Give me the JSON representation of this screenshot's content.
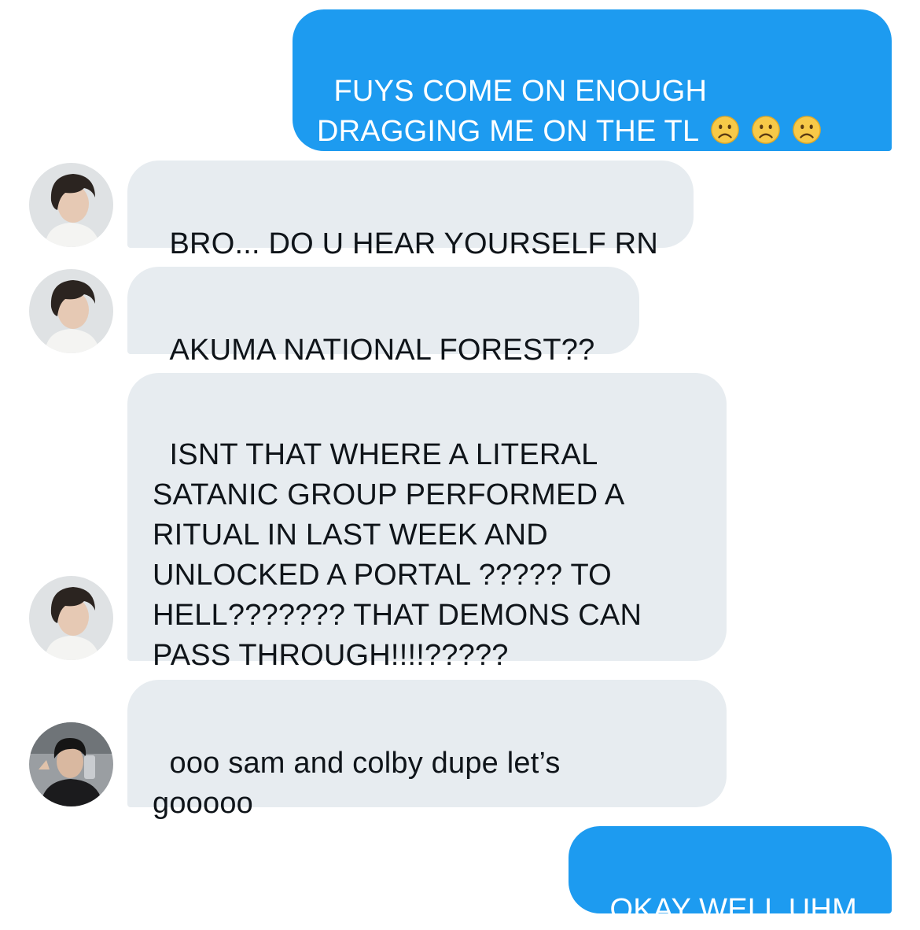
{
  "messages": [
    {
      "id": "m1",
      "side": "sent",
      "text": "FUYS COME ON ENOUGH\nDRAGGING ME ON THE TL",
      "emojis": [
        "slightly-frowning-face-icon",
        "slightly-frowning-face-icon",
        "slightly-frowning-face-icon"
      ]
    },
    {
      "id": "m2",
      "side": "received",
      "sender_avatar": "avatar-user-a",
      "text": "BRO... DO U HEAR YOURSELF RN"
    },
    {
      "id": "m3",
      "side": "received",
      "sender_avatar": "avatar-user-a",
      "text": "AKUMA NATIONAL FOREST??"
    },
    {
      "id": "m4",
      "side": "received",
      "sender_avatar": "avatar-user-a",
      "text": "ISNT THAT WHERE A LITERAL\nSATANIC GROUP PERFORMED A\nRITUAL IN LAST WEEK AND\nUNLOCKED A PORTAL ????? TO\nHELL??????? THAT DEMONS CAN\nPASS THROUGH!!!!?????"
    },
    {
      "id": "m5",
      "side": "received",
      "sender_avatar": "avatar-user-b",
      "text": "ooo sam and colby dupe let’s\ngooooo"
    },
    {
      "id": "m6",
      "side": "sent",
      "text": "OKAY WELL UHM"
    }
  ],
  "colors": {
    "sent_bubble": "#1d9bf0",
    "received_bubble": "#e7ecf0",
    "sent_text": "#ffffff",
    "received_text": "#0f1419"
  }
}
